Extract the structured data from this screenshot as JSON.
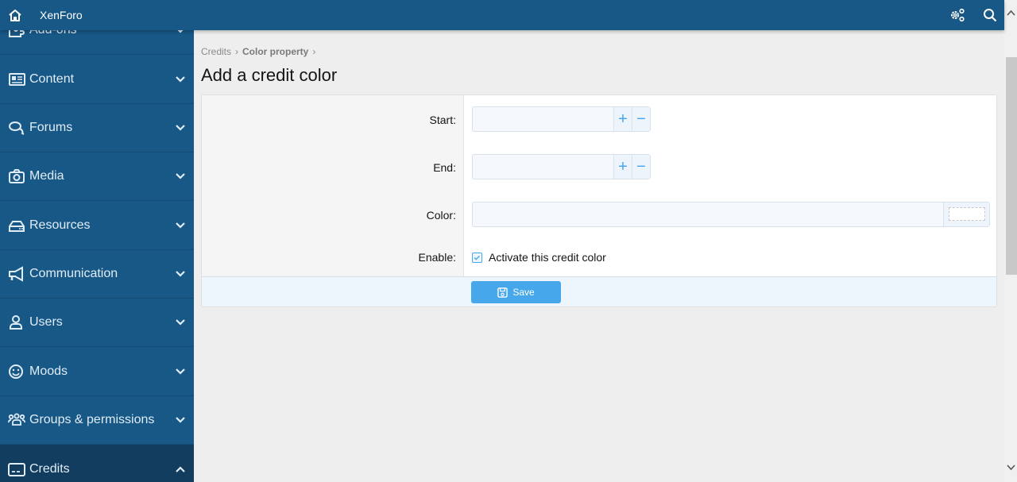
{
  "topbar": {
    "brand": "XenForo",
    "home_icon": "home-icon",
    "tools_icon": "cogs-icon",
    "search_icon": "search-icon"
  },
  "sidebar": {
    "items": [
      {
        "label": "Add-ons",
        "icon": "puzzle-icon",
        "expanded": false
      },
      {
        "label": "Content",
        "icon": "newspaper-icon",
        "expanded": false
      },
      {
        "label": "Forums",
        "icon": "comments-icon",
        "expanded": false
      },
      {
        "label": "Media",
        "icon": "camera-icon",
        "expanded": false
      },
      {
        "label": "Resources",
        "icon": "hdd-icon",
        "expanded": false
      },
      {
        "label": "Communication",
        "icon": "megaphone-icon",
        "expanded": false
      },
      {
        "label": "Users",
        "icon": "user-icon",
        "expanded": false
      },
      {
        "label": "Moods",
        "icon": "smile-icon",
        "expanded": false
      },
      {
        "label": "Groups & permissions",
        "icon": "users-icon",
        "expanded": false
      },
      {
        "label": "Credits",
        "icon": "credit-card-icon",
        "expanded": true,
        "active": true
      }
    ]
  },
  "breadcrumb": [
    {
      "label": "Credits"
    },
    {
      "label": "Color property"
    }
  ],
  "page_title": "Add a credit color",
  "form": {
    "start": {
      "label": "Start:",
      "value": "",
      "plus": "+",
      "minus": "−"
    },
    "end": {
      "label": "End:",
      "value": "",
      "plus": "+",
      "minus": "−"
    },
    "color": {
      "label": "Color:",
      "value": ""
    },
    "enable": {
      "label": "Enable:",
      "checkbox_label": "Activate this credit color",
      "checked": true
    },
    "save_label": "Save"
  },
  "colors": {
    "header": "#185886",
    "sidebar": "#185886",
    "sidebar_active": "#133d5f",
    "accent": "#47a7eb"
  }
}
